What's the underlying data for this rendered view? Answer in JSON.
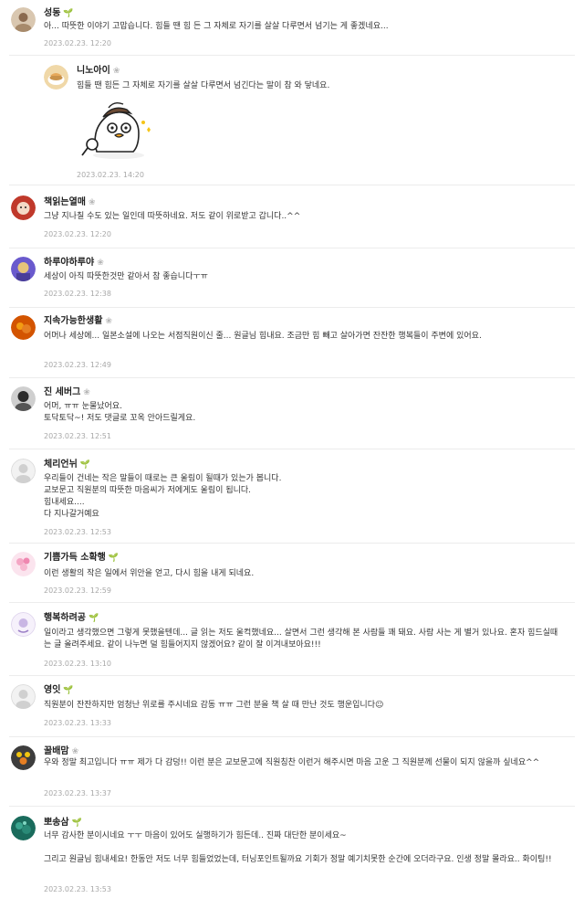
{
  "icons": {
    "sprout": "sprout-badge-icon",
    "grey": "manager-badge-icon"
  },
  "badge_glyphs": {
    "sprout": "🌱",
    "grey": "❀"
  },
  "comments": [
    {
      "name": "성동",
      "badge": "sprout",
      "lines": [
        "아... 따뜻한 이야기 고맙습니다. 힘들 땐 힘 든 그 자체로 자기를 살살 다루면서 넘기는 게 좋겠네요..."
      ],
      "date": "2023.02.23. 12:20"
    },
    {
      "name": "니노아이",
      "badge": "grey",
      "lines": [
        "힘들 땐 힘든 그 자체로 자기를 살살 다루면서 넘긴다는 말이 참 와 닿네요."
      ],
      "date": "2023.02.23. 14:20",
      "reply": true,
      "sticker": "duck-detective-sticker"
    },
    {
      "name": "책읽는열매",
      "badge": "grey",
      "lines": [
        "그냥 지나칠 수도 있는 일인데 따뜻하네요. 저도 같이 위로받고 갑니다..^^"
      ],
      "date": "2023.02.23. 12:20"
    },
    {
      "name": "하루야하루야",
      "badge": "grey",
      "lines": [
        "세상이 아직 따뜻한것만 같아서 참 좋습니다ㅜㅠ"
      ],
      "date": "2023.02.23. 12:38"
    },
    {
      "name": "지속가능한생활",
      "badge": "grey",
      "lines": [
        "어머나 세상에... 일본소설에 나오는 서점직원이신 줄... 원글님 힘내요. 조금만 힘 빼고 살아가면 잔잔한 행복들이 주변에 있어요."
      ],
      "date": "2023.02.23. 12:49"
    },
    {
      "name": "진 세버그",
      "badge": "grey",
      "lines": [
        "어머, ㅠㅠ 눈물났어요.",
        "토닥토닥~! 저도 댓글로 꼬옥 안아드릴게요."
      ],
      "date": "2023.02.23. 12:51"
    },
    {
      "name": "체리언뉘",
      "badge": "sprout",
      "lines": [
        "우리들이 건네는 작은 말들이 때로는 큰 울림이 될때가 있는가 봅니다.",
        "교보문고 직원분의 따뜻한 마음씨가 저에게도 울림이 됩니다.",
        "힘내세요....",
        "다 지나갈거예요"
      ],
      "date": "2023.02.23. 12:53"
    },
    {
      "name": "기쁨가득 소확행",
      "badge": "sprout",
      "lines": [
        "이런 생활의 작은 일에서 위안을 얻고, 다시 힘을 내게 되네요."
      ],
      "date": "2023.02.23. 12:59"
    },
    {
      "name": "행복하려공",
      "badge": "sprout",
      "lines": [
        "일이라고 생각했으면 그렇게 못했을텐데... 글 읽는 저도 울컥했네요... 살면서 그런 생각해 본 사람들 꽤 돼요. 사람 사는 게 별거 있나요. 혼자 힘드실때는 글 올려주세요. 같이 나누면 덜 힘들어지지 않겠어요? 같이 잘 이겨내보아요!!!"
      ],
      "date": "2023.02.23. 13:10"
    },
    {
      "name": "영잇",
      "badge": "sprout",
      "lines": [
        "직원분이 잔잔하지만 엄청난 위로를 주시네요 감동 ㅠㅠ 그런 분을 책 살 때 만난 것도 행운입니다☺"
      ],
      "date": "2023.02.23. 13:33"
    },
    {
      "name": "꿀배맘",
      "badge": "grey",
      "lines": [
        "우와 정말 최고입니다 ㅠㅠ 제가 다 감덩!! 이런 분은 교보문고에 직원칭찬 이런거 해주시면 마음 고운 그 직원분께 선물이 되지 않을까 싶네요^^"
      ],
      "date": "2023.02.23. 13:37"
    },
    {
      "name": "뽀송삼",
      "badge": "sprout",
      "lines": [
        "너무 감사한 분이시네요 ㅜㅜ 마음이 있어도 실행하기가 힘든데.. 진짜 대단한 분이세요~",
        "",
        "그리고 원글님 힘내세요! 한동안 저도 너무 힘들었었는데, 터닝포인트될까요 기회가 정말 예기치못한 순간에 오더라구요. 인생 정말 몰라요.. 화이팅!!"
      ],
      "date": "2023.02.23. 13:53"
    }
  ]
}
